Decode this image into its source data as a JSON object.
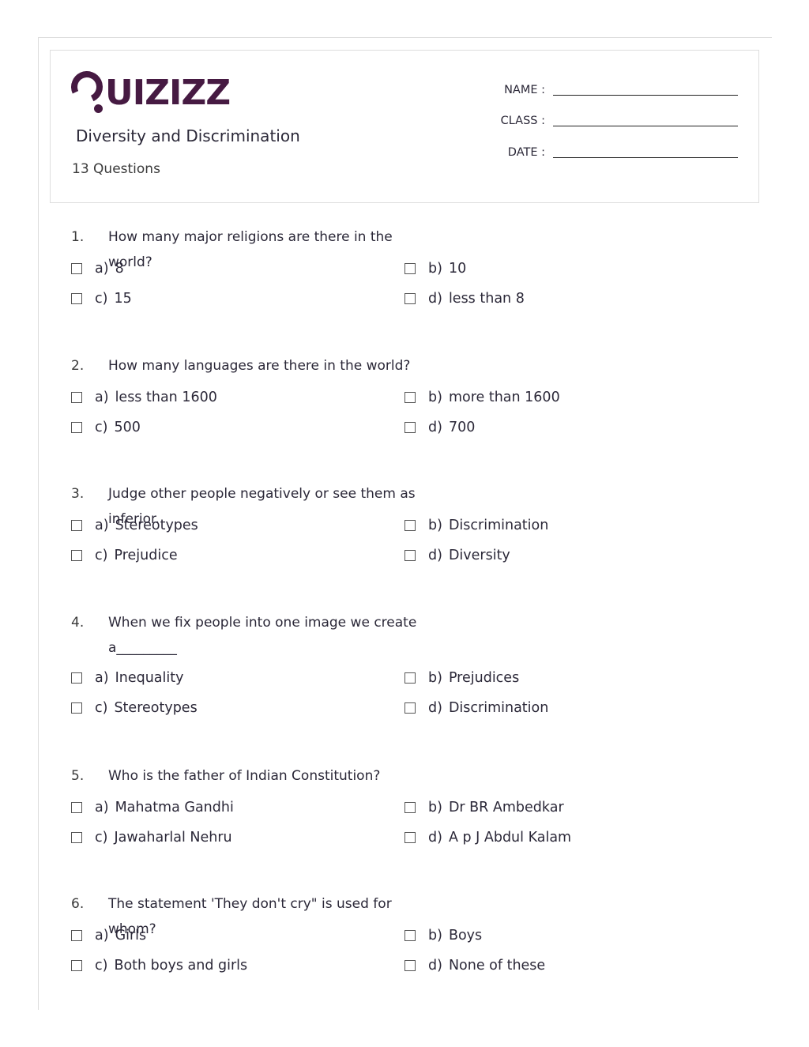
{
  "brand": {
    "logo_text": "Quizizz",
    "logo_color": "#461a42"
  },
  "header": {
    "title": "Diversity and Discrimination",
    "question_count": "13 Questions",
    "fields": [
      {
        "label": "NAME :"
      },
      {
        "label": "CLASS :"
      },
      {
        "label": "DATE :"
      }
    ]
  },
  "questions": [
    {
      "number": "1.",
      "text": "How many major religions are there in the world?",
      "options": [
        {
          "letter": "a)",
          "text": "8"
        },
        {
          "letter": "b)",
          "text": "10"
        },
        {
          "letter": "c)",
          "text": "15"
        },
        {
          "letter": "d)",
          "text": "less than 8"
        }
      ]
    },
    {
      "number": "2.",
      "text": "How many languages are there in the world?",
      "options": [
        {
          "letter": "a)",
          "text": "less than 1600"
        },
        {
          "letter": "b)",
          "text": "more than 1600"
        },
        {
          "letter": "c)",
          "text": "500"
        },
        {
          "letter": "d)",
          "text": "700"
        }
      ]
    },
    {
      "number": "3.",
      "text": "Judge other people negatively or see them as inferior.",
      "options": [
        {
          "letter": "a)",
          "text": "Stereotypes"
        },
        {
          "letter": "b)",
          "text": "Discrimination"
        },
        {
          "letter": "c)",
          "text": "Prejudice"
        },
        {
          "letter": "d)",
          "text": "Diversity"
        }
      ]
    },
    {
      "number": "4.",
      "text": "When we fix people into one image we create a_________",
      "options": [
        {
          "letter": "a)",
          "text": "Inequality"
        },
        {
          "letter": "b)",
          "text": "Prejudices"
        },
        {
          "letter": "c)",
          "text": "Stereotypes"
        },
        {
          "letter": "d)",
          "text": "Discrimination"
        }
      ]
    },
    {
      "number": "5.",
      "text": "Who is the father of Indian Constitution?",
      "options": [
        {
          "letter": "a)",
          "text": "Mahatma Gandhi"
        },
        {
          "letter": "b)",
          "text": "Dr BR Ambedkar"
        },
        {
          "letter": "c)",
          "text": "Jawaharlal Nehru"
        },
        {
          "letter": "d)",
          "text": "A p J Abdul Kalam"
        }
      ]
    },
    {
      "number": "6.",
      "text": "The statement 'They don't cry\" is used for whom?",
      "options": [
        {
          "letter": "a)",
          "text": "Girls"
        },
        {
          "letter": "b)",
          "text": "Boys"
        },
        {
          "letter": "c)",
          "text": "Both boys and girls"
        },
        {
          "letter": "d)",
          "text": "None of these"
        }
      ]
    }
  ]
}
